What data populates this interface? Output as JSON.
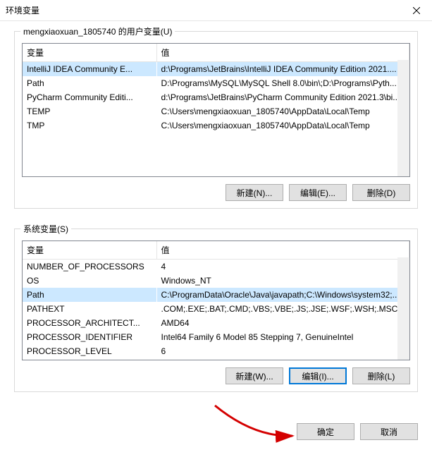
{
  "window": {
    "title": "环境变量"
  },
  "user_vars": {
    "label": "mengxiaoxuan_1805740 的用户变量(U)",
    "headers": {
      "name": "变量",
      "value": "值"
    },
    "rows": [
      {
        "name": "IntelliJ IDEA Community E...",
        "value": "d:\\Programs\\JetBrains\\IntelliJ IDEA Community Edition 2021....",
        "selected": true
      },
      {
        "name": "Path",
        "value": "D:\\Programs\\MySQL\\MySQL Shell 8.0\\bin\\;D:\\Programs\\Pyth..."
      },
      {
        "name": "PyCharm Community Editi...",
        "value": "d:\\Programs\\JetBrains\\PyCharm Community Edition 2021.3\\bi..."
      },
      {
        "name": "TEMP",
        "value": "C:\\Users\\mengxiaoxuan_1805740\\AppData\\Local\\Temp"
      },
      {
        "name": "TMP",
        "value": "C:\\Users\\mengxiaoxuan_1805740\\AppData\\Local\\Temp"
      }
    ],
    "buttons": {
      "new": "新建(N)...",
      "edit": "编辑(E)...",
      "delete": "删除(D)"
    }
  },
  "system_vars": {
    "label": "系统变量(S)",
    "headers": {
      "name": "变量",
      "value": "值"
    },
    "rows": [
      {
        "name": "NUMBER_OF_PROCESSORS",
        "value": "4"
      },
      {
        "name": "OS",
        "value": "Windows_NT"
      },
      {
        "name": "Path",
        "value": "C:\\ProgramData\\Oracle\\Java\\javapath;C:\\Windows\\system32;...",
        "selected": true
      },
      {
        "name": "PATHEXT",
        "value": ".COM;.EXE;.BAT;.CMD;.VBS;.VBE;.JS;.JSE;.WSF;.WSH;.MSC"
      },
      {
        "name": "PROCESSOR_ARCHITECT...",
        "value": "AMD64"
      },
      {
        "name": "PROCESSOR_IDENTIFIER",
        "value": "Intel64 Family 6 Model 85 Stepping 7, GenuineIntel"
      },
      {
        "name": "PROCESSOR_LEVEL",
        "value": "6"
      }
    ],
    "buttons": {
      "new": "新建(W)...",
      "edit": "编辑(I)...",
      "delete": "删除(L)"
    }
  },
  "footer": {
    "ok": "确定",
    "cancel": "取消"
  }
}
